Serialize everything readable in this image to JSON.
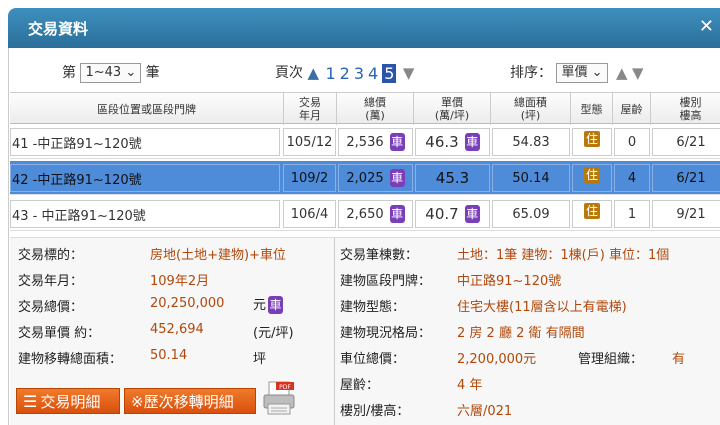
{
  "window": {
    "title": "交易資料",
    "close_glyph": "✕"
  },
  "controls": {
    "prefix": "第",
    "range_selected": "1~43",
    "suffix": "筆",
    "page_label": "頁次",
    "pages": [
      "1",
      "2",
      "3",
      "4",
      "5"
    ],
    "current_page": "5",
    "sort_label": "排序：",
    "sort_selected": "單價"
  },
  "table": {
    "headers": {
      "location": "區段位置或區段門牌",
      "date": [
        "交易",
        "年月"
      ],
      "total": [
        "總價",
        "(萬)"
      ],
      "unit": [
        "單價",
        "(萬/坪)"
      ],
      "area": [
        "總面積",
        "(坪)"
      ],
      "type": "型態",
      "age": "屋齡",
      "floor": [
        "樓別",
        "樓高"
      ]
    },
    "rows": [
      {
        "loc": "41  -中正路91~120號",
        "date": "105/12",
        "total": "2,536",
        "unit": "46.3",
        "area": "54.83",
        "age": "0",
        "floor": "6/21"
      },
      {
        "loc": "42  -中正路91~120號",
        "date": "109/2",
        "total": "2,025",
        "unit": "45.3",
        "area": "50.14",
        "age": "4",
        "floor": "6/21"
      },
      {
        "loc": "43  - 中正路91~120號",
        "date": "106/4",
        "total": "2,650",
        "unit": "40.7",
        "area": "65.09",
        "age": "1",
        "floor": "9/21"
      }
    ],
    "car_badge": "車",
    "type_badge": "住"
  },
  "detail": {
    "left": [
      {
        "label": "交易標的：",
        "value": "房地(土地+建物)+車位"
      },
      {
        "label": "交易年月：",
        "value": "109年2月"
      },
      {
        "label": "交易總價：",
        "value": "20,250,000",
        "unit": "元"
      },
      {
        "label": "交易單價 約：",
        "value": "452,694",
        "unit": "(元/坪)"
      },
      {
        "label": "建物移轉總面積：",
        "value": "50.14",
        "unit": "坪"
      }
    ],
    "right": [
      {
        "label": "交易筆棟數：",
        "value": "土地：1筆 建物：1棟(戶) 車位：1個"
      },
      {
        "label": "建物區段門牌：",
        "value": "中正路91~120號"
      },
      {
        "label": "建物型態：",
        "value": "住宅大樓(11層含以上有電梯)"
      },
      {
        "label": "建物現況格局：",
        "value": "2 房 2 廳 2 衛 有隔間"
      },
      {
        "label": "車位總價：",
        "value": "2,200,000元"
      },
      {
        "label": "屋齡：",
        "value": "4 年"
      },
      {
        "label": "樓別/樓高：",
        "value": "六層/021"
      }
    ],
    "mgmt_label": "管理組織：",
    "mgmt_value": "有"
  },
  "buttons": {
    "detail": "交易明細",
    "history": "※歷次移轉明細",
    "pdf_text": "PDF"
  },
  "colors": {
    "titlebar": "#2a6f9a",
    "selected_row": "#4e8bd8",
    "car_badge": "#7a3fb8",
    "value_text": "#b0480c",
    "button": "#e0601a"
  }
}
